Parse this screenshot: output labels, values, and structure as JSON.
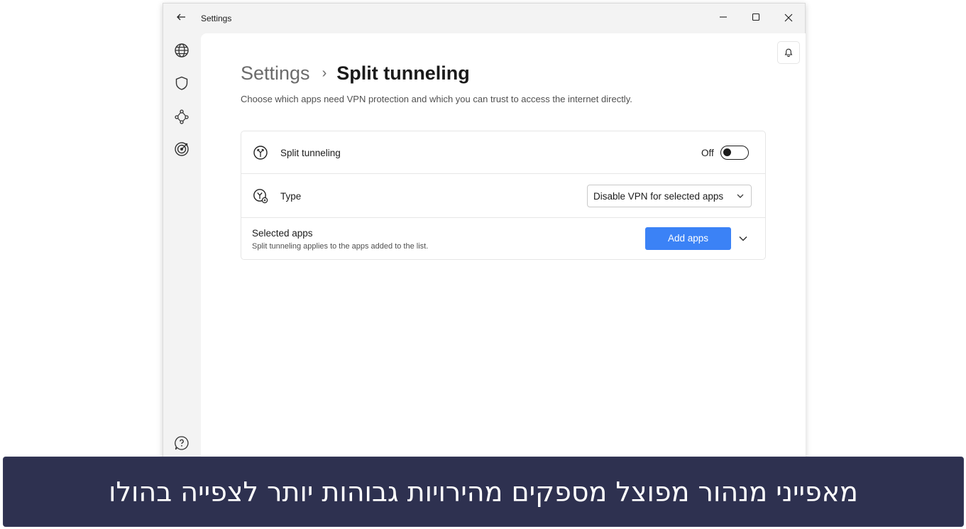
{
  "window": {
    "title": "Settings",
    "back_icon": "arrow-left-icon",
    "controls": {
      "minimize": "−",
      "maximize": "☐",
      "close": "✕"
    }
  },
  "rail": {
    "items": [
      {
        "name": "globe-icon"
      },
      {
        "name": "shield-icon"
      },
      {
        "name": "mesh-network-icon"
      },
      {
        "name": "target-icon"
      }
    ],
    "help_icon": "help-bubble-icon"
  },
  "header": {
    "bell_icon": "bell-icon",
    "breadcrumb_parent": "Settings",
    "breadcrumb_separator": "›",
    "breadcrumb_current": "Split tunneling",
    "subtitle": "Choose which apps need VPN protection and which you can trust to access the internet directly."
  },
  "split_tunneling": {
    "label": "Split tunneling",
    "state_text": "Off",
    "enabled": false
  },
  "type": {
    "label": "Type",
    "selected": "Disable VPN for selected apps"
  },
  "selected_apps": {
    "title": "Selected apps",
    "description": "Split tunneling applies to the apps added to the list.",
    "add_button": "Add apps"
  },
  "banner": {
    "text": "מאפייני מנהור מפוצל מספקים מהירויות גבוהות יותר לצפייה בהולו"
  },
  "colors": {
    "accent": "#3b82f6",
    "banner_bg": "#2e3150",
    "rail_bg": "#f3f3f3"
  }
}
